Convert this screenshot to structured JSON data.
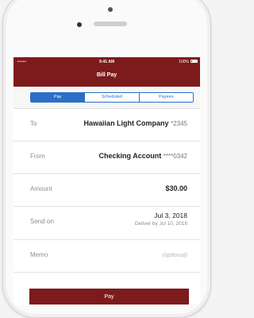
{
  "status_bar": {
    "signal": "•••••",
    "time": "9:41 AM",
    "battery": "100%"
  },
  "header": {
    "title": "Bill Pay"
  },
  "tabs": [
    {
      "label": "Pay",
      "active": true
    },
    {
      "label": "Scheduled",
      "active": false
    },
    {
      "label": "Payees",
      "active": false
    }
  ],
  "form": {
    "to": {
      "label": "To",
      "value": "Hawaiian Light Company",
      "mask": "*2345"
    },
    "from": {
      "label": "From",
      "value": "Checking Account",
      "mask": "****0342"
    },
    "amount": {
      "label": "Amount",
      "value": "$30.00"
    },
    "send_on": {
      "label": "Send on",
      "date": "Jul 3, 2018",
      "deliver": "Deliver by Jul 10, 2018"
    },
    "memo": {
      "label": "Memo",
      "placeholder": "(optional)"
    }
  },
  "actions": {
    "pay_label": "Pay"
  },
  "colors": {
    "brand": "#7d1a1c",
    "accent": "#2a6fc7"
  }
}
